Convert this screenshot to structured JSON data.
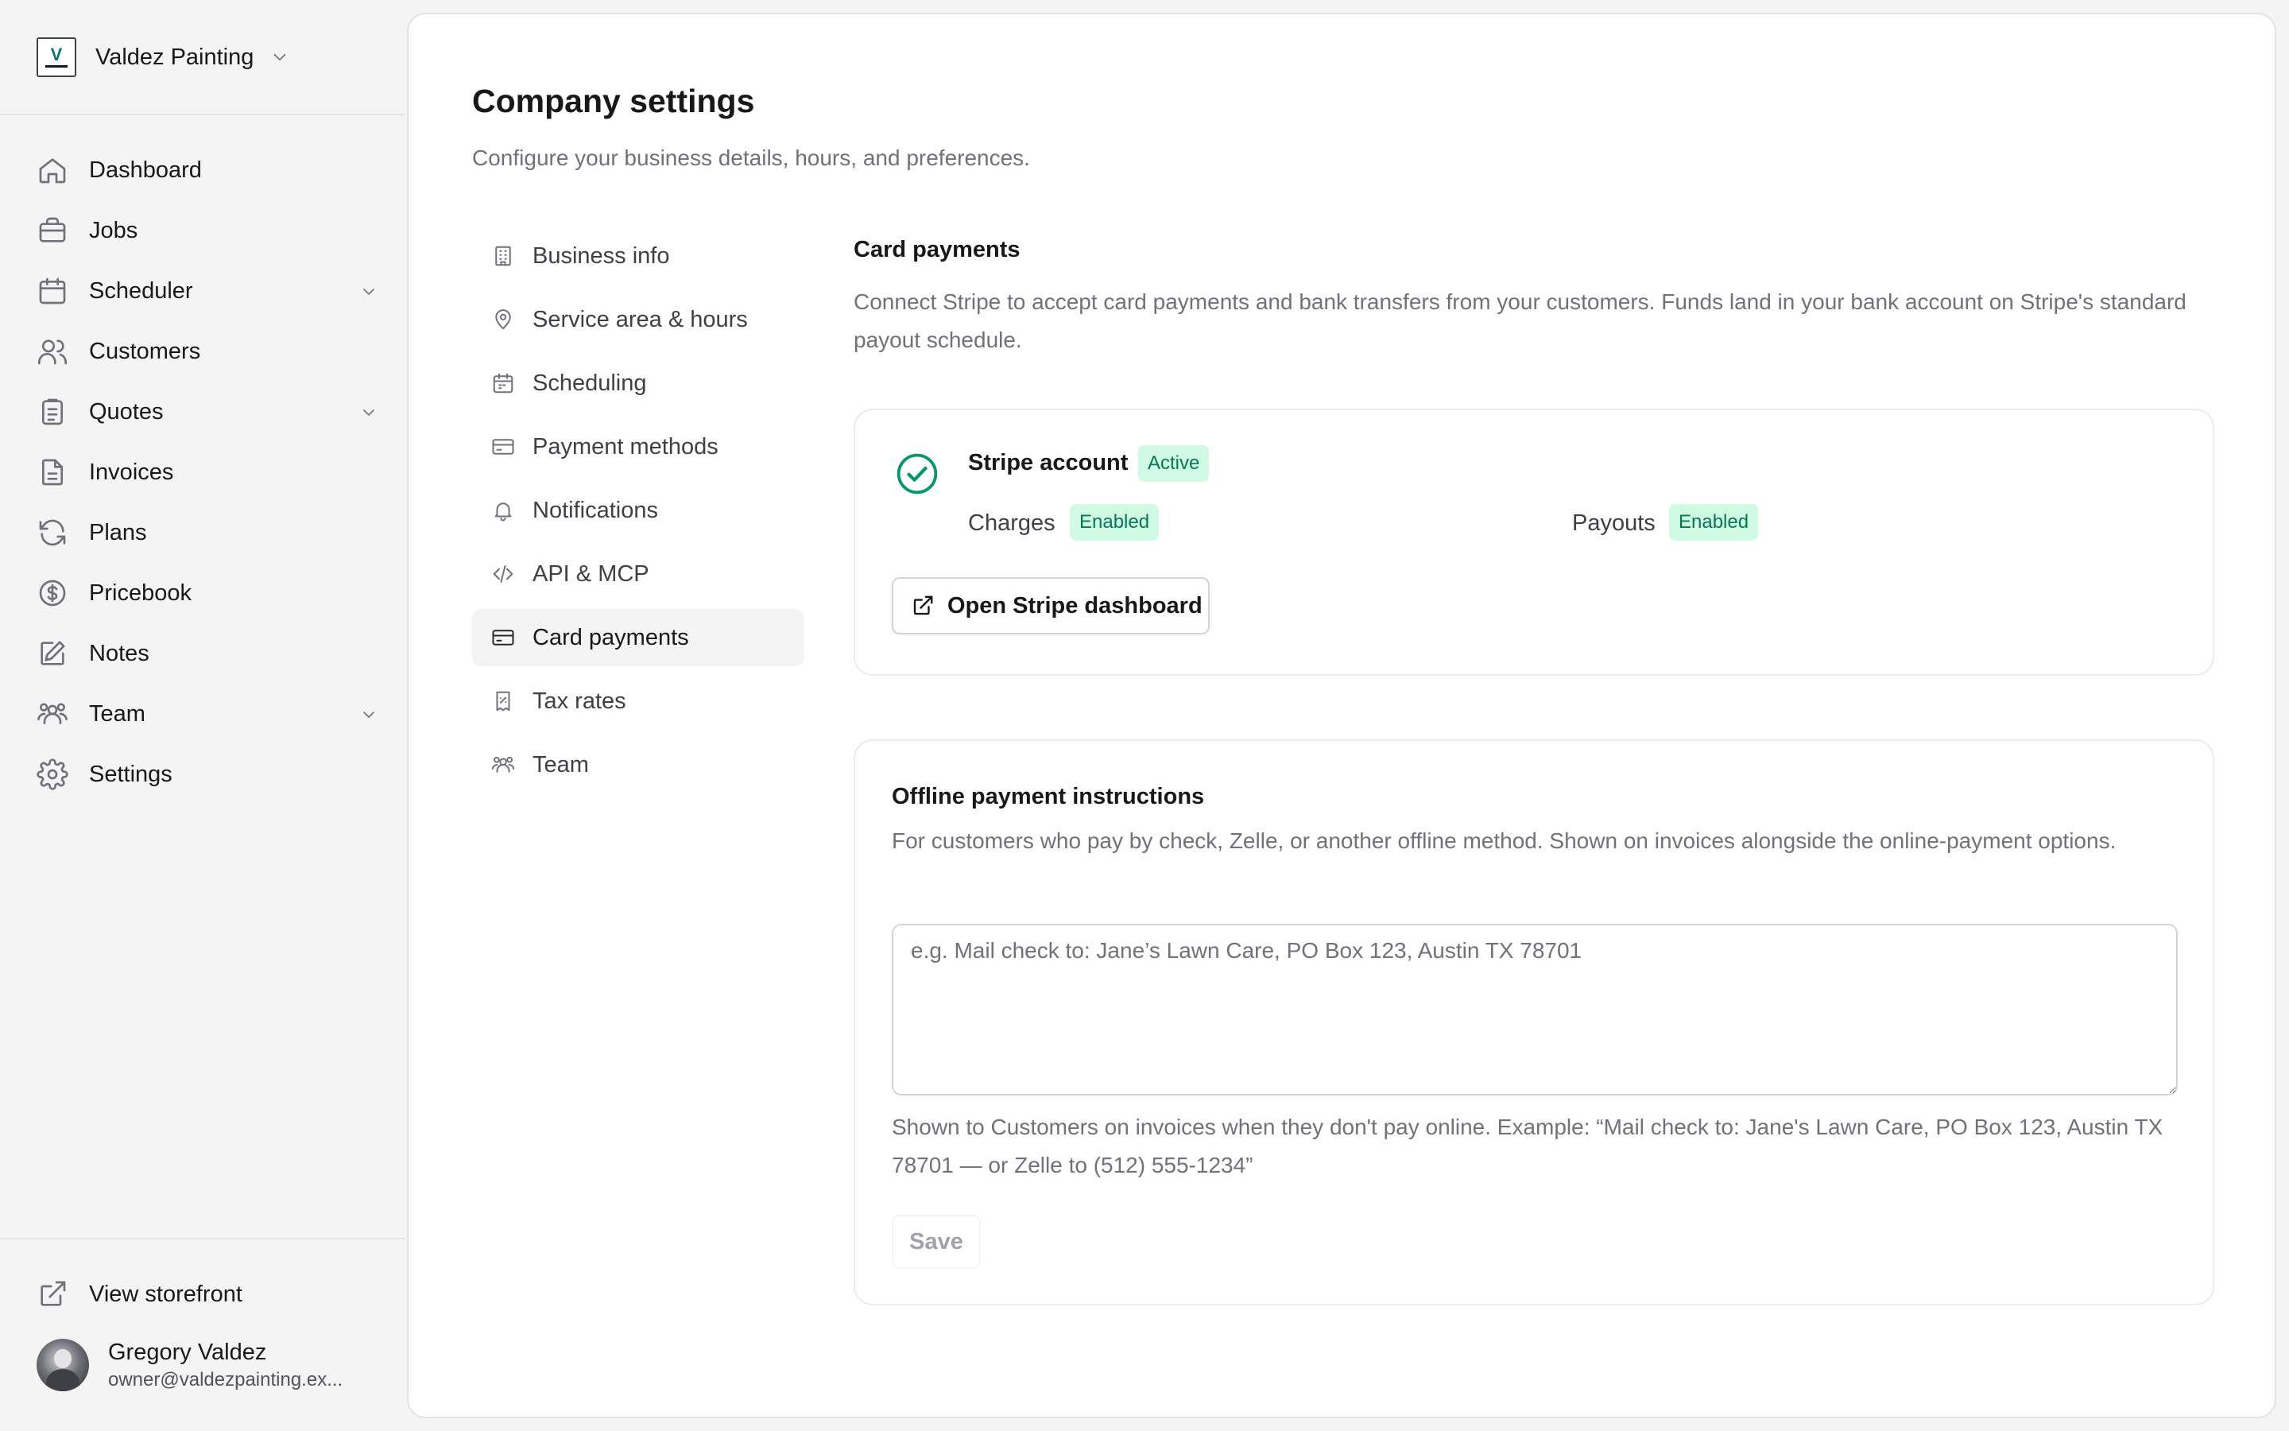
{
  "org": {
    "name": "Valdez Painting",
    "logo_letter": "V"
  },
  "sidebar": {
    "items": [
      {
        "label": "Dashboard",
        "icon": "home-icon"
      },
      {
        "label": "Jobs",
        "icon": "briefcase-icon"
      },
      {
        "label": "Scheduler",
        "icon": "calendar-icon",
        "expandable": true
      },
      {
        "label": "Customers",
        "icon": "users-icon"
      },
      {
        "label": "Quotes",
        "icon": "clipboard-icon",
        "expandable": true
      },
      {
        "label": "Invoices",
        "icon": "file-icon"
      },
      {
        "label": "Plans",
        "icon": "refresh-icon"
      },
      {
        "label": "Pricebook",
        "icon": "dollar-circle-icon"
      },
      {
        "label": "Notes",
        "icon": "pencil-icon"
      },
      {
        "label": "Team",
        "icon": "team-icon",
        "expandable": true
      },
      {
        "label": "Settings",
        "icon": "gear-icon"
      }
    ],
    "view_storefront": "View storefront",
    "user": {
      "name": "Gregory Valdez",
      "email": "owner@valdezpainting.ex..."
    }
  },
  "page": {
    "title": "Company settings",
    "subtitle": "Configure your business details, hours, and preferences."
  },
  "settings_nav": [
    {
      "label": "Business info",
      "icon": "building-icon"
    },
    {
      "label": "Service area & hours",
      "icon": "map-pin-icon"
    },
    {
      "label": "Scheduling",
      "icon": "calendar-icon"
    },
    {
      "label": "Payment methods",
      "icon": "credit-card-icon"
    },
    {
      "label": "Notifications",
      "icon": "bell-icon"
    },
    {
      "label": "API & MCP",
      "icon": "code-icon"
    },
    {
      "label": "Card payments",
      "icon": "credit-card-icon",
      "active": true
    },
    {
      "label": "Tax rates",
      "icon": "receipt-icon"
    },
    {
      "label": "Team",
      "icon": "team-icon"
    }
  ],
  "card_payments": {
    "title": "Card payments",
    "description": "Connect Stripe to accept card payments and bank transfers from your customers. Funds land in your bank account on Stripe's standard payout schedule.",
    "stripe": {
      "title": "Stripe account",
      "status": "Active",
      "charges_label": "Charges",
      "charges_status": "Enabled",
      "payouts_label": "Payouts",
      "payouts_status": "Enabled",
      "open_button": "Open Stripe dashboard"
    },
    "offline": {
      "title": "Offline payment instructions",
      "description": "For customers who pay by check, Zelle, or another offline method. Shown on invoices alongside the online-payment options.",
      "value": "",
      "placeholder": "e.g. Mail check to: Jane’s Lawn Care, PO Box 123, Austin TX 78701",
      "help": "Shown to Customers on invoices when they don't pay online. Example: “Mail check to: Jane's Lawn Care, PO Box 123, Austin TX 78701 — or Zelle to (512) 555-1234”",
      "save_label": "Save"
    }
  },
  "colors": {
    "accent_green": "#047857",
    "badge_bg": "#d1fae5",
    "check_green": "#059669"
  }
}
